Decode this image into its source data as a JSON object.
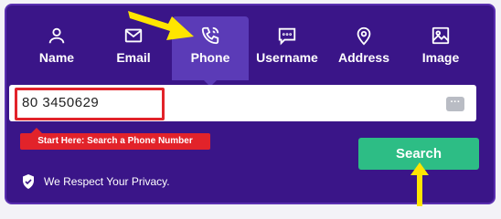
{
  "tabs": [
    {
      "label": "Name",
      "icon": "user-icon",
      "active": false
    },
    {
      "label": "Email",
      "icon": "email-icon",
      "active": false
    },
    {
      "label": "Phone",
      "icon": "phone-icon",
      "active": true
    },
    {
      "label": "Username",
      "icon": "chat-icon",
      "active": false
    },
    {
      "label": "Address",
      "icon": "map-pin-icon",
      "active": false
    },
    {
      "label": "Image",
      "icon": "image-icon",
      "active": false
    }
  ],
  "search": {
    "value": "80 3450629",
    "more_icon": "more-dots-icon"
  },
  "hint": {
    "label": "Start Here: Search a Phone Number"
  },
  "button": {
    "label": "Search"
  },
  "privacy": {
    "label": "We Respect Your Privacy.",
    "icon": "shield-check-icon"
  },
  "colors": {
    "panel_bg": "#3a1588",
    "active_tab": "#5b3bb7",
    "search_button": "#2dbd85",
    "highlight_red": "#e2232a",
    "annotation_yellow": "#ffe500"
  }
}
